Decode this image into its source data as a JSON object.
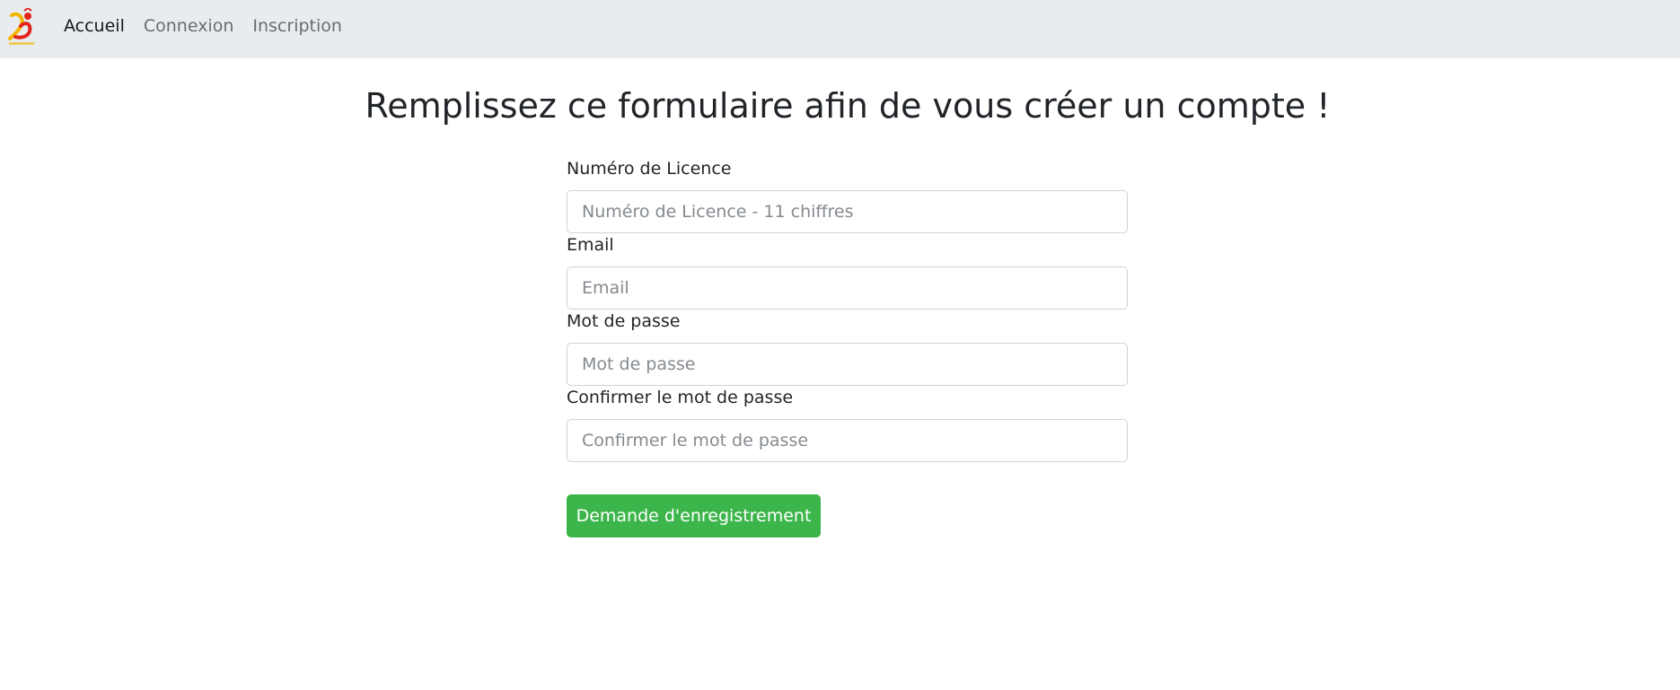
{
  "navbar": {
    "logo_icon": "handball-logo-icon",
    "links": [
      {
        "label": "Accueil",
        "active": true
      },
      {
        "label": "Connexion",
        "active": false
      },
      {
        "label": "Inscription",
        "active": false
      }
    ]
  },
  "page": {
    "title": "Remplissez ce formulaire afin de vous créer un compte !"
  },
  "form": {
    "license": {
      "label": "Numéro de Licence",
      "placeholder": "Numéro de Licence - 11 chiffres",
      "value": ""
    },
    "email": {
      "label": "Email",
      "placeholder": "Email",
      "value": ""
    },
    "password": {
      "label": "Mot de passe",
      "placeholder": "Mot de passe",
      "value": ""
    },
    "confirm_password": {
      "label": "Confirmer le mot de passe",
      "placeholder": "Confirmer le mot de passe",
      "value": ""
    },
    "submit_label": "Demande d'enregistrement"
  },
  "colors": {
    "navbar_bg": "#e9ecef",
    "accent_green": "#3cb54a",
    "logo_red": "#e2231a",
    "logo_yellow": "#f4b400"
  }
}
